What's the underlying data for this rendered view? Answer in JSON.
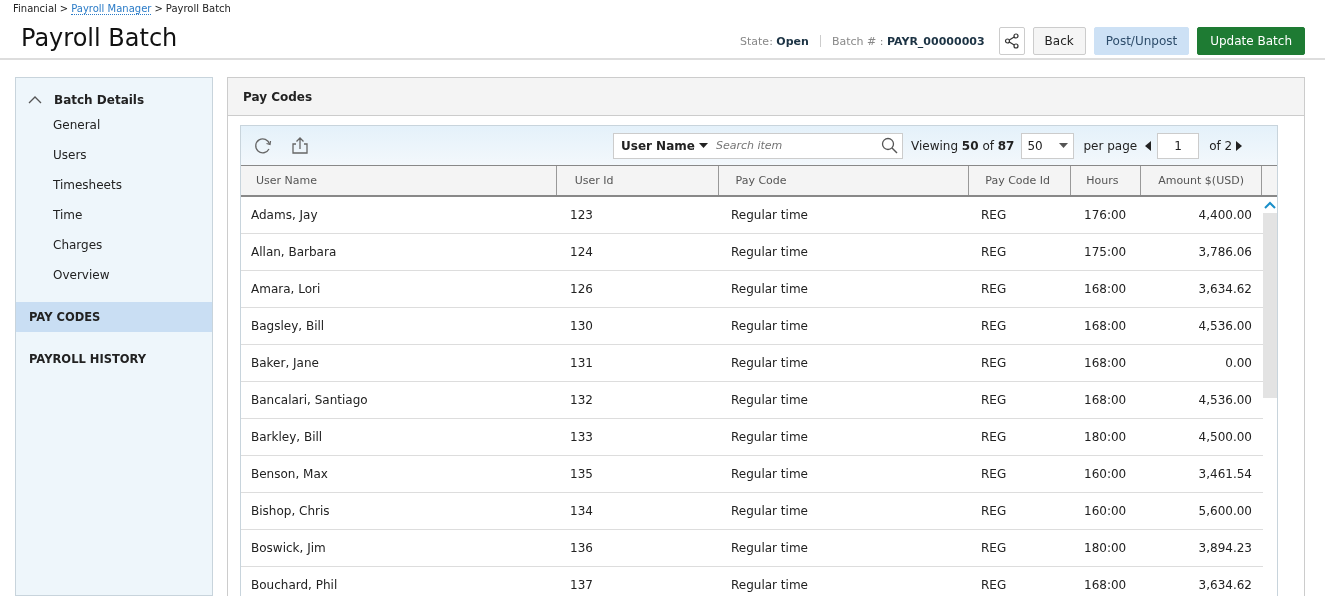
{
  "breadcrumb": [
    {
      "label": "Financial",
      "link": false
    },
    {
      "label": "Payroll Manager",
      "link": true
    },
    {
      "label": "Payroll Batch",
      "link": false
    }
  ],
  "breadcrumb_separator": ">",
  "title": "Payroll Batch",
  "state": {
    "label": "State:",
    "value": "Open"
  },
  "batch": {
    "label": "Batch # :",
    "value": "PAYR_00000003"
  },
  "buttons": [
    {
      "label": "Back",
      "kind": "default"
    },
    {
      "label": "Post/Unpost",
      "kind": "light"
    },
    {
      "label": "Update Batch",
      "kind": "primary"
    }
  ],
  "sidebar": {
    "group": {
      "label": "Batch Details",
      "expanded": true,
      "children": [
        {
          "label": "General"
        },
        {
          "label": "Users"
        },
        {
          "label": "Timesheets"
        },
        {
          "label": "Time"
        },
        {
          "label": "Charges"
        },
        {
          "label": "Overview"
        }
      ]
    },
    "sections": [
      {
        "label": "PAY CODES",
        "selected": true
      },
      {
        "label": "PAYROLL HISTORY",
        "selected": false
      }
    ]
  },
  "panel": {
    "title": "Pay Codes"
  },
  "toolbar": {
    "search_by": "User Name",
    "placeholder": "Search item",
    "viewing_label": "Viewing",
    "viewing_count": "50",
    "of_label": "of",
    "total": "87",
    "per_page_value": "50",
    "per_page_label": "per page",
    "page": "1",
    "page_of": "of 2"
  },
  "table": {
    "columns": [
      {
        "label": "User Name"
      },
      {
        "label": "User Id"
      },
      {
        "label": "Pay Code"
      },
      {
        "label": "Pay Code Id"
      },
      {
        "label": "Hours"
      },
      {
        "label": "Amount $(USD)"
      }
    ],
    "rows": [
      [
        "Adams, Jay",
        "123",
        "Regular time",
        "REG",
        "176:00",
        "4,400.00"
      ],
      [
        "Allan, Barbara",
        "124",
        "Regular time",
        "REG",
        "175:00",
        "3,786.06"
      ],
      [
        "Amara, Lori",
        "126",
        "Regular time",
        "REG",
        "168:00",
        "3,634.62"
      ],
      [
        "Bagsley, Bill",
        "130",
        "Regular time",
        "REG",
        "168:00",
        "4,536.00"
      ],
      [
        "Baker, Jane",
        "131",
        "Regular time",
        "REG",
        "168:00",
        "0.00"
      ],
      [
        "Bancalari, Santiago",
        "132",
        "Regular time",
        "REG",
        "168:00",
        "4,536.00"
      ],
      [
        "Barkley, Bill",
        "133",
        "Regular time",
        "REG",
        "180:00",
        "4,500.00"
      ],
      [
        "Benson, Max",
        "135",
        "Regular time",
        "REG",
        "160:00",
        "3,461.54"
      ],
      [
        "Bishop, Chris",
        "134",
        "Regular time",
        "REG",
        "160:00",
        "5,600.00"
      ],
      [
        "Boswick, Jim",
        "136",
        "Regular time",
        "REG",
        "180:00",
        "3,894.23"
      ],
      [
        "Bouchard, Phil",
        "137",
        "Regular time",
        "REG",
        "168:00",
        "3,634.62"
      ]
    ]
  }
}
